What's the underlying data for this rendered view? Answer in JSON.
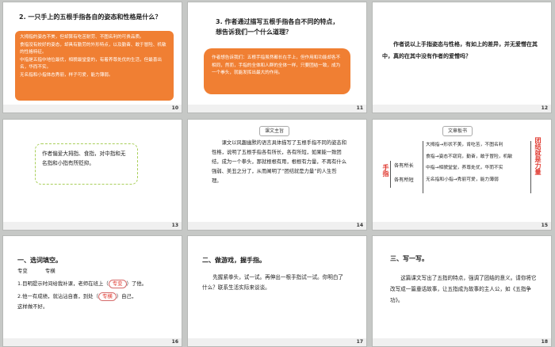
{
  "slides": [
    {
      "number": "10",
      "title": "2. 一只手上的五根手指各自的姿态和性格是什么？",
      "box_lines": [
        "大拇指的姿态不美，但却算有吃苦耐劳、不图名利的可贵品质。",
        "食指没有姣好的姿态，却具有勤劳的外形特点，以及勤奋、敢于冒险、机敏的性格特征。",
        "中指是五指中地位最优，相貌最堂皇的，有着养尊处优的生活，但最喜出名，华而不实。",
        "无名指和小指体态秀丽，样子可爱，能力薄弱。"
      ]
    },
    {
      "number": "11",
      "title": "3. 作者通过描写五根手指各自不同的特点，想告诉我们一个什么道理？",
      "box_text": "作者想告诉我们：五根手指虽然都长在手上，但作用和功能却各不相同，然而，手指的全体和人群的全体一样，只要团结一致，成为一个拳头，就能发挥出最大的作用。"
    },
    {
      "number": "12",
      "text": "作者说以上手指姿态与性格，有如上的差异，并无爱憎在其中，真的在其中没有作者的爱憎吗？"
    },
    {
      "number": "13",
      "box_text": "作者偏爱大拇指、食指，对中指和无名指和小指有所贬抑。"
    },
    {
      "number": "14",
      "tag": "课文主旨",
      "text": "课文以风趣幽默的语言具体描写了五根手指不同的姿态和性格，说明了五根手指各有所长，各有所短，如果能一致团结，成为一个拳头，那就根根有用，根根有力量，不再有什么强弱、美丑之分了，从而阐明了“团结就是力量”的人生哲理。"
    },
    {
      "number": "15",
      "tag": "文章板书",
      "left_label": "手指",
      "mid_items": [
        "各有所长",
        "各有所短"
      ],
      "rows": [
        "大拇指→形状不美，肯吃苦，不图名利",
        "食指→姿态不窈窕，勤奋，敢于冒险，机敏",
        "中指→相貌堂堂，养尊处优，华而不实",
        "无名指和小指→秀丽可爱，能力薄弱"
      ],
      "right_label": "团结就是力量"
    },
    {
      "number": "16",
      "title": "一、选词填空。",
      "words": [
        "专变",
        "专横"
      ],
      "q1_before": "1.目明提示时间给我补课，老师在班上（",
      "q1_answer": "专变",
      "q1_after": "）了他。",
      "q2_before": "2.他一有成绩，就沾沾自喜，到处（",
      "q2_answer": "专横",
      "q2_after": "）自己，",
      "q2_line2": "这样做不好。"
    },
    {
      "number": "17",
      "title": "二、做游戏，握手指。",
      "text": "先握紧拳头，试一试。再伸出一根手指试一试。你明白了什么？联系生活实际来谈谈。"
    },
    {
      "number": "18",
      "title": "三、写一写。",
      "text": "这篇课文写出了五指的特点，强调了团结的意义。请你将它改写成一篇童话故事，让五指成为故事的主人公，如《五指争功》。"
    }
  ]
}
